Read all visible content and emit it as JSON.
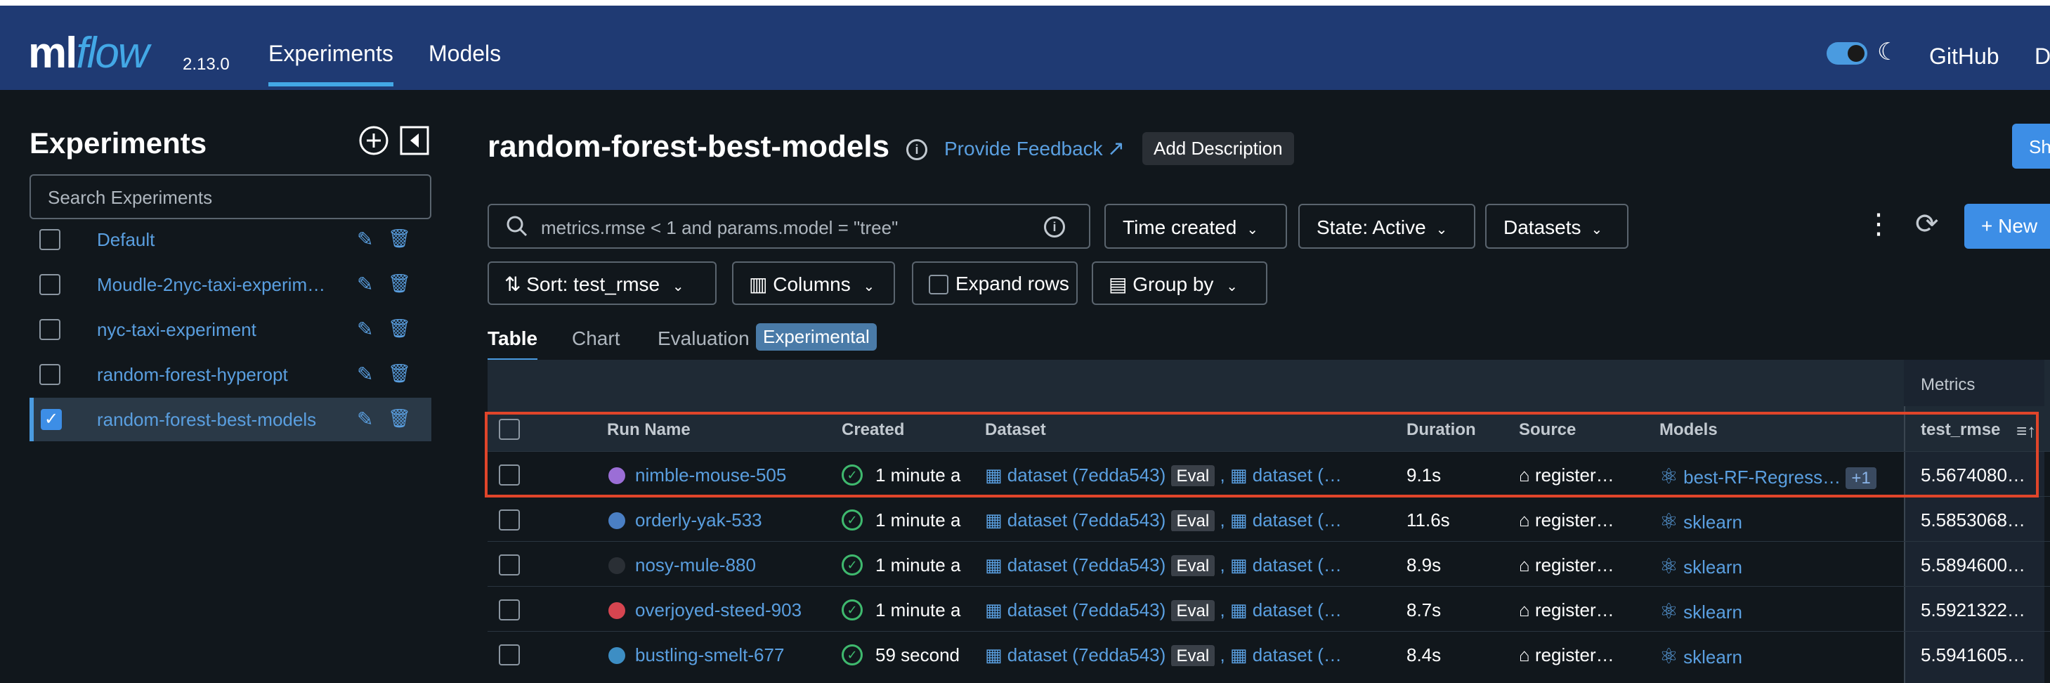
{
  "header": {
    "logo_ml": "ml",
    "logo_flow": "flow",
    "version": "2.13.0",
    "nav": [
      {
        "label": "Experiments"
      },
      {
        "label": "Models"
      }
    ],
    "github": "GitHub",
    "docs": "D"
  },
  "sidebar": {
    "title": "Experiments",
    "search_placeholder": "Search Experiments",
    "items": [
      {
        "label": "Default",
        "checked": false
      },
      {
        "label": "Moudle-2nyc-taxi-experim…",
        "checked": false
      },
      {
        "label": "nyc-taxi-experiment",
        "checked": false
      },
      {
        "label": "random-forest-hyperopt",
        "checked": false
      },
      {
        "label": "random-forest-best-models",
        "checked": true
      }
    ]
  },
  "main": {
    "title": "random-forest-best-models",
    "feedback_link": "Provide Feedback",
    "add_description": "Add Description",
    "share_label": "Sh",
    "query": "metrics.rmse < 1 and params.model = \"tree\"",
    "filters": {
      "time_created": "Time created",
      "state": "State: Active",
      "datasets": "Datasets",
      "new_run": "New"
    },
    "controls": {
      "sort": "Sort: test_rmse",
      "columns": "Columns",
      "expand_rows": "Expand rows",
      "group_by": "Group by"
    },
    "tabs": [
      {
        "label": "Table"
      },
      {
        "label": "Chart"
      },
      {
        "label": "Evaluation"
      }
    ],
    "experimental_badge": "Experimental"
  },
  "table": {
    "metrics_group": "Metrics",
    "headers": {
      "run_name": "Run Name",
      "created": "Created",
      "dataset": "Dataset",
      "duration": "Duration",
      "source": "Source",
      "models": "Models",
      "metric": "test_rmse"
    },
    "rows": [
      {
        "name": "nimble-mouse-505",
        "color": "#9b6ed6",
        "created": "1 minute a",
        "dataset": "dataset (7edda543)",
        "eval": "Eval",
        "dataset2": "dataset (…",
        "duration": "9.1s",
        "source": "register…",
        "model": "best-RF-Regress…",
        "extra": "+1",
        "metric": "5.5674080…"
      },
      {
        "name": "orderly-yak-533",
        "color": "#4a7fc4",
        "created": "1 minute a",
        "dataset": "dataset (7edda543)",
        "eval": "Eval",
        "dataset2": "dataset (…",
        "duration": "11.6s",
        "source": "register…",
        "model": "sklearn",
        "extra": "",
        "metric": "5.5853068…"
      },
      {
        "name": "nosy-mule-880",
        "color": "#2a2f35",
        "created": "1 minute a",
        "dataset": "dataset (7edda543)",
        "eval": "Eval",
        "dataset2": "dataset (…",
        "duration": "8.9s",
        "source": "register…",
        "model": "sklearn",
        "extra": "",
        "metric": "5.5894600…"
      },
      {
        "name": "overjoyed-steed-903",
        "color": "#d64550",
        "created": "1 minute a",
        "dataset": "dataset (7edda543)",
        "eval": "Eval",
        "dataset2": "dataset (…",
        "duration": "8.7s",
        "source": "register…",
        "model": "sklearn",
        "extra": "",
        "metric": "5.5921322…"
      },
      {
        "name": "bustling-smelt-677",
        "color": "#3d8ec4",
        "created": "59 second",
        "dataset": "dataset (7edda543)",
        "eval": "Eval",
        "dataset2": "dataset (…",
        "duration": "8.4s",
        "source": "register…",
        "model": "sklearn",
        "extra": "",
        "metric": "5.5941605…"
      }
    ]
  }
}
